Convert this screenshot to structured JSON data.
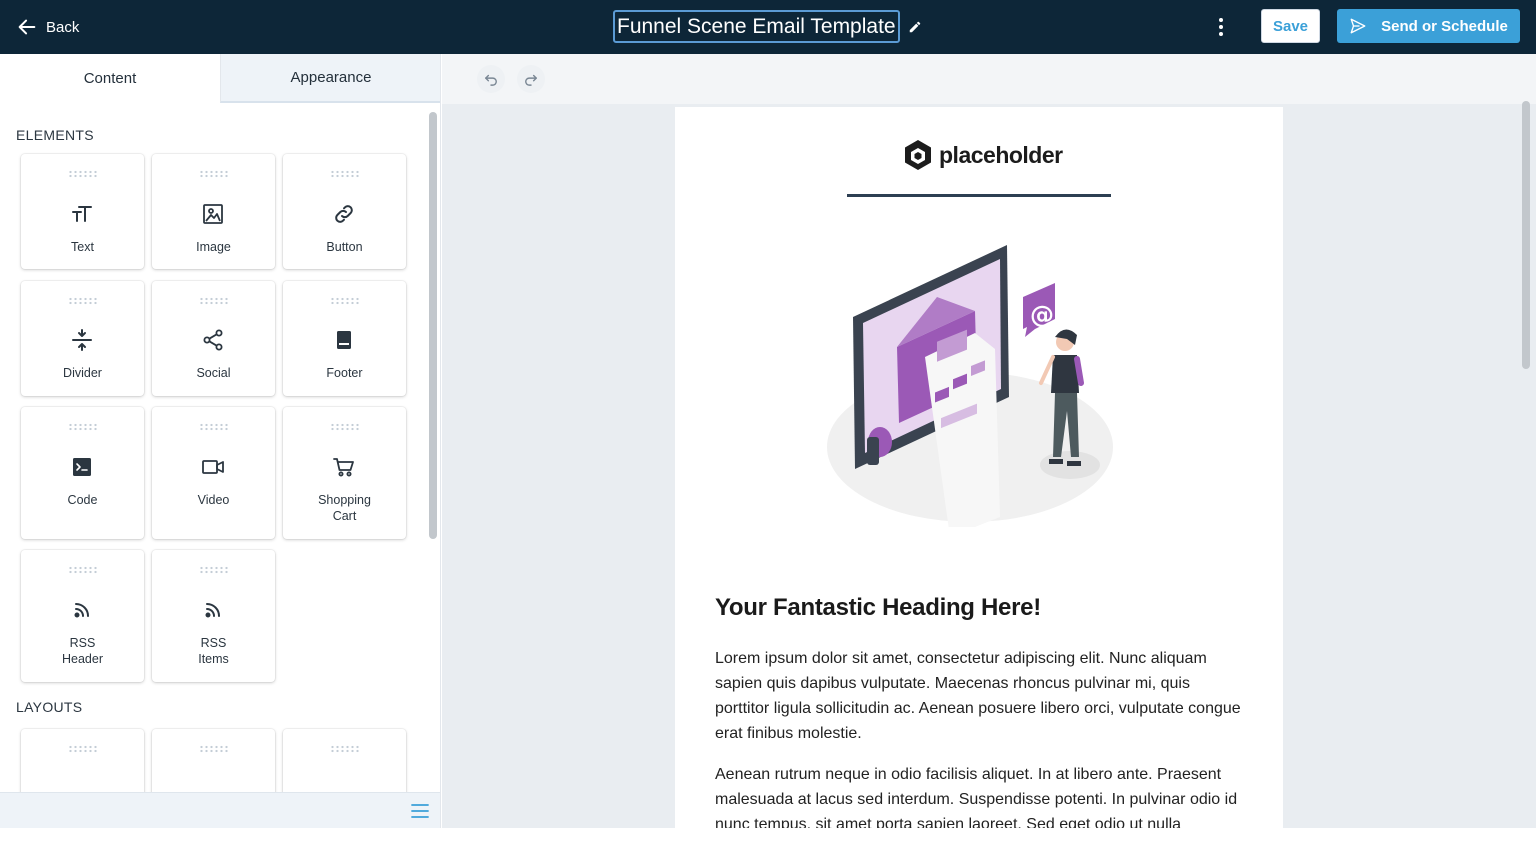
{
  "header": {
    "back_label": "Back",
    "title": "Funnel Scene Email Template",
    "save_label": "Save",
    "send_label": "Send or Schedule"
  },
  "panel": {
    "tabs": [
      {
        "label": "Content",
        "active": true
      },
      {
        "label": "Appearance",
        "active": false
      }
    ],
    "elements_label": "ELEMENTS",
    "layouts_label": "LAYOUTS",
    "elements": [
      {
        "label": "Text",
        "icon": "text-icon"
      },
      {
        "label": "Image",
        "icon": "image-icon"
      },
      {
        "label": "Button",
        "icon": "link-icon"
      },
      {
        "label": "Divider",
        "icon": "divider-icon"
      },
      {
        "label": "Social",
        "icon": "share-icon"
      },
      {
        "label": "Footer",
        "icon": "footer-icon"
      },
      {
        "label": "Code",
        "icon": "terminal-icon"
      },
      {
        "label": "Video",
        "icon": "video-icon"
      },
      {
        "label": "Shopping\nCart",
        "icon": "cart-icon"
      },
      {
        "label": "RSS\nHeader",
        "icon": "rss-icon"
      },
      {
        "label": "RSS\nItems",
        "icon": "rss-icon"
      }
    ]
  },
  "email": {
    "logo_text": "placeholder",
    "heading": "Your Fantastic Heading Here!",
    "paragraph_1": "Lorem ipsum dolor sit amet, consectetur adipiscing elit. Nunc aliquam sapien quis dapibus vulputate. Maecenas rhoncus pulvinar mi, quis porttitor ligula sollicitudin ac. Aenean posuere libero orci, vulputate congue erat finibus molestie.",
    "paragraph_2": "Aenean rutrum neque in odio facilisis aliquet. In at libero ante. Praesent malesuada at lacus sed interdum. Suspendisse potenti. In pulvinar odio id nunc tempus, sit amet porta sapien laoreet. Sed eget odio ut nulla"
  },
  "colors": {
    "topbar": "#0d2638",
    "accent": "#3ba0d8",
    "illustration_purple": "#9b59b6"
  }
}
